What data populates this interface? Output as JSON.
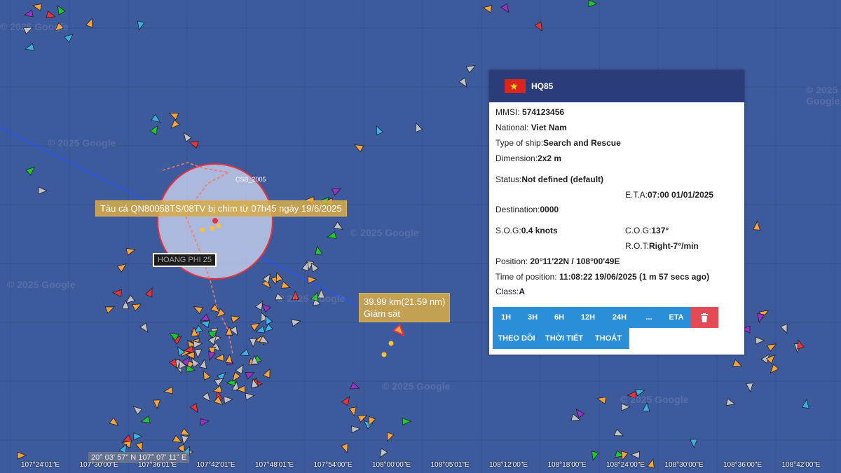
{
  "map": {
    "watermarks": [
      "© 2025 Google",
      "© 2025 Google",
      "© 2025 Google",
      "© 2025 Google",
      "© 2025 Google",
      "© 2025 Google",
      "© 2025 Google",
      "© 2025 Google"
    ],
    "incident_label": "Tàu cá QN80058TS/08TV bị chìm từ 07h45 ngày 19/6/2025",
    "ship_tag": "HOANG PHI 25",
    "csb_label": "CSB_2005",
    "measure_distance": "39.99 km(21.59 nm)",
    "measure_note": "Giám sát",
    "cursor_position": "20° 03' 57\" N 107° 07' 11\" E",
    "longitude_labels": [
      "107°24'01\"E",
      "107°30'00\"E",
      "107°36'01\"E",
      "107°42'01\"E",
      "107°48'01\"E",
      "107°54'00\"E",
      "108°00'00\"E",
      "108°05'01\"E",
      "108°12'00\"E",
      "108°18'00\"E",
      "108°24'00\"E",
      "108°30'00\"E",
      "108°36'00\"E",
      "108°42'00\"E"
    ]
  },
  "panel": {
    "flag_icon": "vietnam-flag-icon",
    "ship_name": "HQ85",
    "mmsi_label": "MMSI:",
    "mmsi_value": "574123456",
    "nation_label": "National:",
    "nation_value": "Viet Nam",
    "type_label": "Type of ship:",
    "type_value": "Search and Rescue",
    "dim_label": "Dimension:",
    "dim_value": "2x2 m",
    "status_label": "Status:",
    "status_value": "Not defined (default)",
    "eta_label": "E.T.A:",
    "eta_value": "07:00 01/01/2025",
    "dest_label": "Destination:",
    "dest_value": "0000",
    "sog_label": "S.O.G:",
    "sog_value": "0.4 knots",
    "cog_label": "C.O.G:",
    "cog_value": "137°",
    "rot_label": "R.O.T:",
    "rot_value": "Right-7°/min",
    "pos_label": "Position:",
    "pos_value": "20°11'22N / 108°00'49E",
    "time_label": "Time of position:",
    "time_value": "11:08:22 19/06/2025 (1 m 57 secs ago)",
    "class_label": "Class:",
    "class_value": "A",
    "history_buttons": [
      "1H",
      "3H",
      "6H",
      "12H",
      "24H",
      "...",
      "ETA"
    ],
    "delete_icon": "trash-icon",
    "action_buttons": [
      "THEO DÕI",
      "THỜI TIẾT",
      "THOÁT"
    ]
  }
}
